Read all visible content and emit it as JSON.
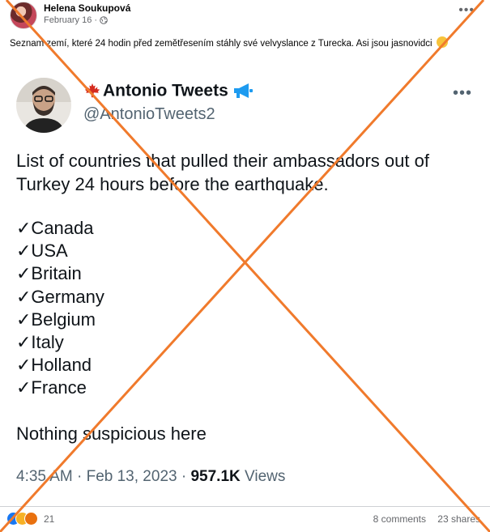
{
  "post": {
    "author": "Helena Soukupová",
    "date": "February 16 ·",
    "text": "Seznam zemí, které 24 hodin před zemětřesením stáhly své velvyslance z Turecka. Asi jsou jasnovidci",
    "more_icon": "more-horizontal-icon",
    "privacy_icon": "globe-icon"
  },
  "tweet": {
    "display_name": "Antonio Tweets",
    "handle": "@AntonioTweets2",
    "body": "List of countries that pulled their ambassadors out of Turkey 24 hours before the earthquake.",
    "countries": [
      "✓Canada",
      "✓USA",
      "✓Britain",
      "✓Germany",
      "✓Belgium",
      "✓Italy",
      "✓Holland",
      "✓France"
    ],
    "closing": "Nothing suspicious here",
    "time": "4:35 AM · Feb 13, 2023 · ",
    "views_count": "957.1K",
    "views_label": " Views"
  },
  "footer": {
    "reaction_count": "21",
    "comments": "8 comments",
    "shares": "23 shares"
  },
  "colors": {
    "cross": "#f07a2c",
    "facebook_blue": "#1877f2",
    "twitter_blue": "#1d9bf0",
    "maple_red": "#d52b1e"
  }
}
